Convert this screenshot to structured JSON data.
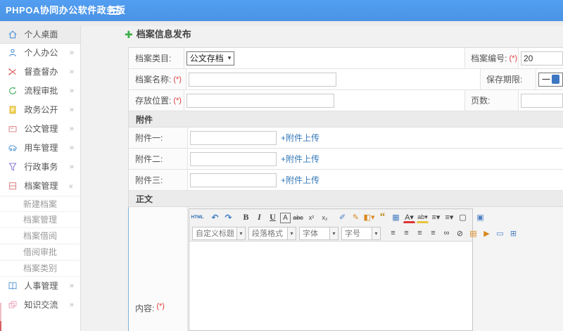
{
  "topbar": {
    "title": "PHPOA协同办公软件政务版"
  },
  "sidebar": {
    "chevron": "»",
    "items": [
      {
        "label": "个人桌面",
        "icon": "home-icon"
      },
      {
        "label": "个人办公",
        "icon": "user-icon"
      },
      {
        "label": "督查督办",
        "icon": "supervise-icon"
      },
      {
        "label": "流程审批",
        "icon": "approval-icon"
      },
      {
        "label": "政务公开",
        "icon": "disclosure-icon"
      },
      {
        "label": "公文管理",
        "icon": "document-icon"
      },
      {
        "label": "用车管理",
        "icon": "vehicle-icon"
      },
      {
        "label": "行政事务",
        "icon": "admin-icon"
      },
      {
        "label": "档案管理",
        "icon": "archive-icon"
      },
      {
        "label": "人事管理",
        "icon": "hr-icon"
      },
      {
        "label": "知识交流",
        "icon": "knowledge-icon"
      }
    ],
    "submenu": [
      "新建档案",
      "档案管理",
      "档案借阅",
      "借阅审批",
      "档案类别"
    ]
  },
  "main": {
    "page_title": "档案信息发布",
    "plus_icon": "✚",
    "required_mark": "(*)",
    "form": {
      "category_label": "档案类目:",
      "category_value": "公文存档",
      "number_label": "档案编号:",
      "number_value": "20",
      "name_label": "档案名称:",
      "period_label": "保存期限:",
      "period_value": "一",
      "location_label": "存放位置:",
      "pages_label": "页数:",
      "attachments_header": "附件",
      "attachment_labels": [
        "附件一:",
        "附件二:",
        "附件三:"
      ],
      "upload_link": "+附件上传",
      "body_header": "正文",
      "content_label": "内容:"
    },
    "editor": {
      "caret": "▾",
      "selects": [
        {
          "name": "custom-title",
          "label": "自定义标题"
        },
        {
          "name": "paragraph-format",
          "label": "段落格式"
        },
        {
          "name": "font-family",
          "label": "字体"
        },
        {
          "name": "font-size",
          "label": "字号"
        }
      ],
      "row1": [
        {
          "name": "source-code",
          "glyph": "HTML"
        },
        {
          "name": "undo",
          "glyph": "↶"
        },
        {
          "name": "redo",
          "glyph": "↷"
        },
        {
          "name": "bold",
          "glyph": "B"
        },
        {
          "name": "italic",
          "glyph": "I"
        },
        {
          "name": "underline",
          "glyph": "U"
        },
        {
          "name": "text-border",
          "glyph": "A"
        },
        {
          "name": "strikethrough",
          "glyph": "abc"
        },
        {
          "name": "superscript",
          "glyph": "x²"
        },
        {
          "name": "subscript",
          "glyph": "x₂"
        },
        {
          "name": "remove-format",
          "glyph": "✐"
        },
        {
          "name": "format-brush",
          "glyph": "✎"
        },
        {
          "name": "paint-color",
          "glyph": "◧▾"
        },
        {
          "name": "blockquote",
          "glyph": "“"
        },
        {
          "name": "plugins",
          "glyph": "▦"
        },
        {
          "name": "font-color",
          "glyph": "A▾"
        },
        {
          "name": "highlight-color",
          "glyph": "ab▾"
        },
        {
          "name": "ordered-list",
          "glyph": "≡▾"
        },
        {
          "name": "unordered-list",
          "glyph": "≡▾"
        },
        {
          "name": "new-document",
          "glyph": "▢"
        },
        {
          "name": "fullscreen",
          "glyph": "▣"
        }
      ],
      "row2": [
        {
          "name": "align-left",
          "glyph": "≡"
        },
        {
          "name": "align-center",
          "glyph": "≡"
        },
        {
          "name": "align-right",
          "glyph": "≡"
        },
        {
          "name": "align-justify",
          "glyph": "≡"
        },
        {
          "name": "link",
          "glyph": "∞"
        },
        {
          "name": "unlink",
          "glyph": "⊘"
        },
        {
          "name": "image",
          "glyph": "▤"
        },
        {
          "name": "flash",
          "glyph": "▶"
        },
        {
          "name": "media",
          "glyph": "▭"
        },
        {
          "name": "table",
          "glyph": "⊞"
        }
      ]
    }
  },
  "colors": {
    "topbar_blue": "#4f9af0",
    "link_blue": "#3579b8",
    "required_red": "#e33c3c",
    "plus_green": "#3fae49"
  }
}
